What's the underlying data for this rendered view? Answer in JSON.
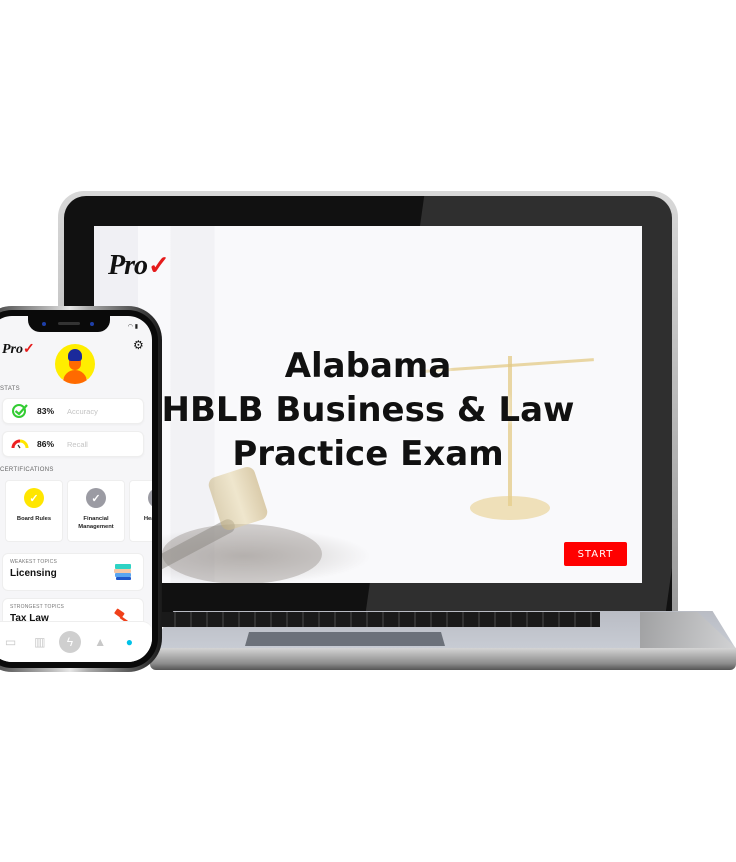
{
  "laptop": {
    "brand": {
      "text": "Pro",
      "mark": "✓"
    },
    "title_lines": [
      "Alabama",
      "HBLB Business & Law",
      "Practice Exam"
    ],
    "start_label": "START",
    "accent_color": "#ff0000"
  },
  "phone": {
    "brand": {
      "text": "Pro",
      "mark": "✓"
    },
    "status_icons": "wifi-icon battery-icon",
    "stats_label": "STATS",
    "stats": [
      {
        "icon": "check-circle-icon",
        "value": "83%",
        "label": "Accuracy"
      },
      {
        "icon": "gauge-icon",
        "value": "86%",
        "label": "Recall"
      }
    ],
    "certifications_label": "CERTIFICATIONS",
    "certifications": [
      {
        "name": "Board Rules",
        "badge_color": "#ffe600",
        "earned": true
      },
      {
        "name": "Financial Management",
        "badge_color": "#9b9ba3",
        "earned": false
      },
      {
        "name": "Health Saf",
        "badge_color": "#9b9ba3",
        "earned": false
      }
    ],
    "weakest": {
      "kicker": "WEAKEST TOPICS",
      "name": "Licensing",
      "icon": "books-icon"
    },
    "strongest": {
      "kicker": "STRONGEST TOPICS",
      "name": "Tax Law",
      "icon": "gavel-icon"
    },
    "tabs": [
      {
        "name": "cards",
        "glyph": "▭"
      },
      {
        "name": "study",
        "glyph": "📖"
      },
      {
        "name": "quick",
        "glyph": "⚡"
      },
      {
        "name": "notifications",
        "glyph": "🔔"
      },
      {
        "name": "profile",
        "glyph": "👤",
        "active": true
      }
    ],
    "active_color": "#00c2e8"
  }
}
